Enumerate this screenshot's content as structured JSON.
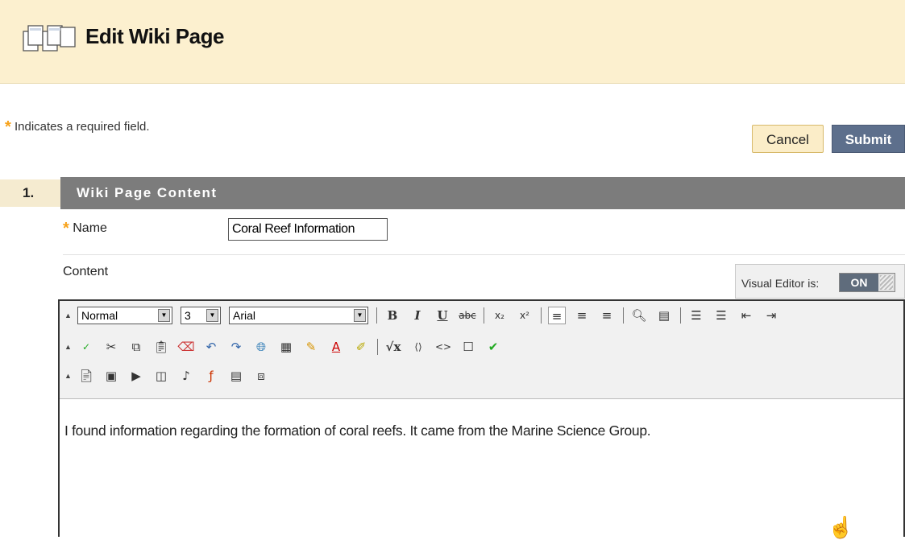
{
  "header": {
    "title": "Edit Wiki Page",
    "icon": "wiki-pages-icon"
  },
  "required_note": {
    "star": "*",
    "text": "Indicates a required field."
  },
  "actions": {
    "cancel_label": "Cancel",
    "submit_label": "Submit"
  },
  "section": {
    "number": "1.",
    "title": "Wiki Page Content"
  },
  "fields": {
    "name_label": "Name",
    "name_value": "Coral Reef Information",
    "content_label": "Content"
  },
  "visual_editor": {
    "label": "Visual Editor is:",
    "state": "ON"
  },
  "toolbar": {
    "format_value": "Normal",
    "size_value": "3",
    "font_value": "Arial"
  },
  "editor": {
    "body_text": "I found information regarding the formation of coral reefs. It came from the Marine Science Group."
  },
  "colors": {
    "header_bg": "#fcf0cf",
    "section_bar": "#7c7c7c",
    "submit_bg": "#5d6f8c",
    "required_star": "#f7a21b"
  }
}
